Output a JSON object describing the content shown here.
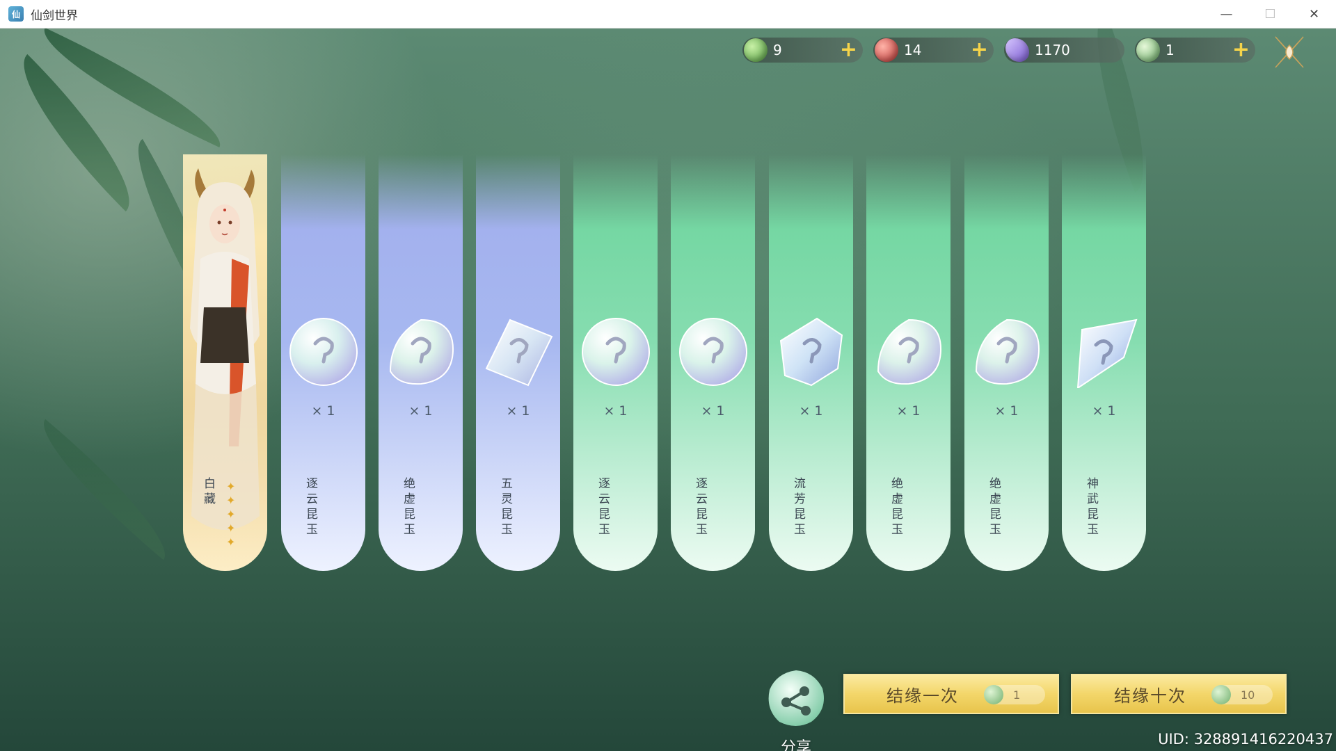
{
  "window": {
    "title": "仙剑世界",
    "app_icon": "xianjian-app-icon",
    "controls": [
      "minimize-icon",
      "maximize-icon",
      "close-icon"
    ],
    "minimize_glyph": "—",
    "maximize_glyph": "☐",
    "close_glyph": "✕"
  },
  "resources": [
    {
      "name": "green-spirit-stone",
      "value": "9",
      "plus": "+",
      "color": "#6fbf5a"
    },
    {
      "name": "red-spirit-stone",
      "value": "14",
      "plus": "+",
      "color": "#d9514e"
    },
    {
      "name": "purple-crystal",
      "value": "1170",
      "plus": "",
      "color": "#9a7fe0"
    },
    {
      "name": "jade-token",
      "value": "1",
      "plus": "+",
      "color": "#8fd48a"
    }
  ],
  "cards": [
    {
      "type": "character",
      "name": "白藏",
      "stars": 5,
      "rarity": "gold"
    },
    {
      "type": "item",
      "icon": "sphere",
      "qty": "× 1",
      "name": "逐云昆玉",
      "rarity": "blue"
    },
    {
      "type": "item",
      "icon": "drop",
      "qty": "× 1",
      "name": "绝虚昆玉",
      "rarity": "blue"
    },
    {
      "type": "item",
      "icon": "rect-gem",
      "qty": "× 1",
      "name": "五灵昆玉",
      "rarity": "blue"
    },
    {
      "type": "item",
      "icon": "sphere",
      "qty": "× 1",
      "name": "逐云昆玉",
      "rarity": "green"
    },
    {
      "type": "item",
      "icon": "sphere",
      "qty": "× 1",
      "name": "逐云昆玉",
      "rarity": "green"
    },
    {
      "type": "item",
      "icon": "hex-gem",
      "qty": "× 1",
      "name": "流芳昆玉",
      "rarity": "green"
    },
    {
      "type": "item",
      "icon": "drop",
      "qty": "× 1",
      "name": "绝虚昆玉",
      "rarity": "green"
    },
    {
      "type": "item",
      "icon": "drop",
      "qty": "× 1",
      "name": "绝虚昆玉",
      "rarity": "green"
    },
    {
      "type": "item",
      "icon": "shard",
      "qty": "× 1",
      "name": "神武昆玉",
      "rarity": "green"
    }
  ],
  "share": {
    "label": "分享"
  },
  "buttons": [
    {
      "label": "结缘一次",
      "cost": "1"
    },
    {
      "label": "结缘十次",
      "cost": "10"
    }
  ],
  "uid": "UID: 328891416220437"
}
